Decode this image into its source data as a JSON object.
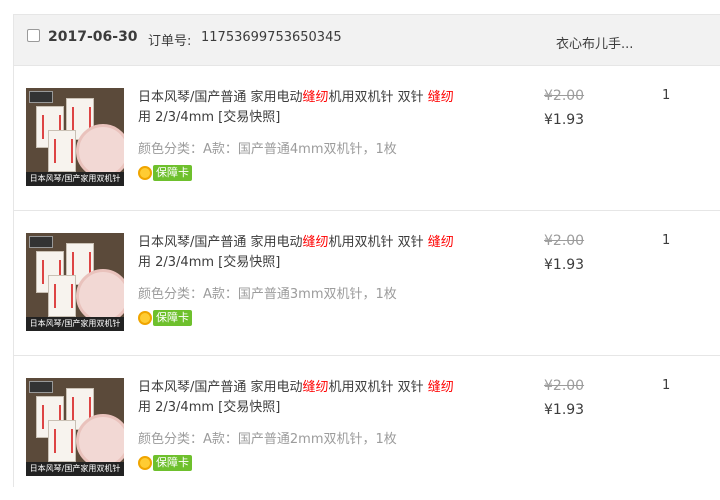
{
  "order": {
    "date": "2017-06-30",
    "order_no_label": "订单号:",
    "order_no": "11753699753650345",
    "shop": "衣心布儿手..."
  },
  "items": [
    {
      "title_a": "日本风琴/国产普通 家用电动",
      "title_hl1": "缝纫",
      "title_b": "机用双机针 双针 ",
      "title_hl2": "缝纫",
      "title_c": "用 2/3/4mm [交易快照]",
      "sku": "颜色分类：A款：国产普通4mm双机针，1枚",
      "badge": "保障卡",
      "price_original": "¥2.00",
      "price_now": "¥1.93",
      "qty": "1",
      "thumb_banner": "日本风琴/国产家用双机针"
    },
    {
      "title_a": "日本风琴/国产普通 家用电动",
      "title_hl1": "缝纫",
      "title_b": "机用双机针 双针 ",
      "title_hl2": "缝纫",
      "title_c": "用 2/3/4mm [交易快照]",
      "sku": "颜色分类：A款：国产普通3mm双机针，1枚",
      "badge": "保障卡",
      "price_original": "¥2.00",
      "price_now": "¥1.93",
      "qty": "1",
      "thumb_banner": "日本风琴/国产家用双机针"
    },
    {
      "title_a": "日本风琴/国产普通 家用电动",
      "title_hl1": "缝纫",
      "title_b": "机用双机针 双针 ",
      "title_hl2": "缝纫",
      "title_c": "用 2/3/4mm [交易快照]",
      "sku": "颜色分类：A款：国产普通2mm双机针，1枚",
      "badge": "保障卡",
      "price_original": "¥2.00",
      "price_now": "¥1.93",
      "qty": "1",
      "thumb_banner": "日本风琴/国产家用双机针"
    }
  ],
  "colors": {
    "highlight": "#ff0000",
    "badge_green": "#6ec02d",
    "header_bg": "#f2f2f2"
  }
}
